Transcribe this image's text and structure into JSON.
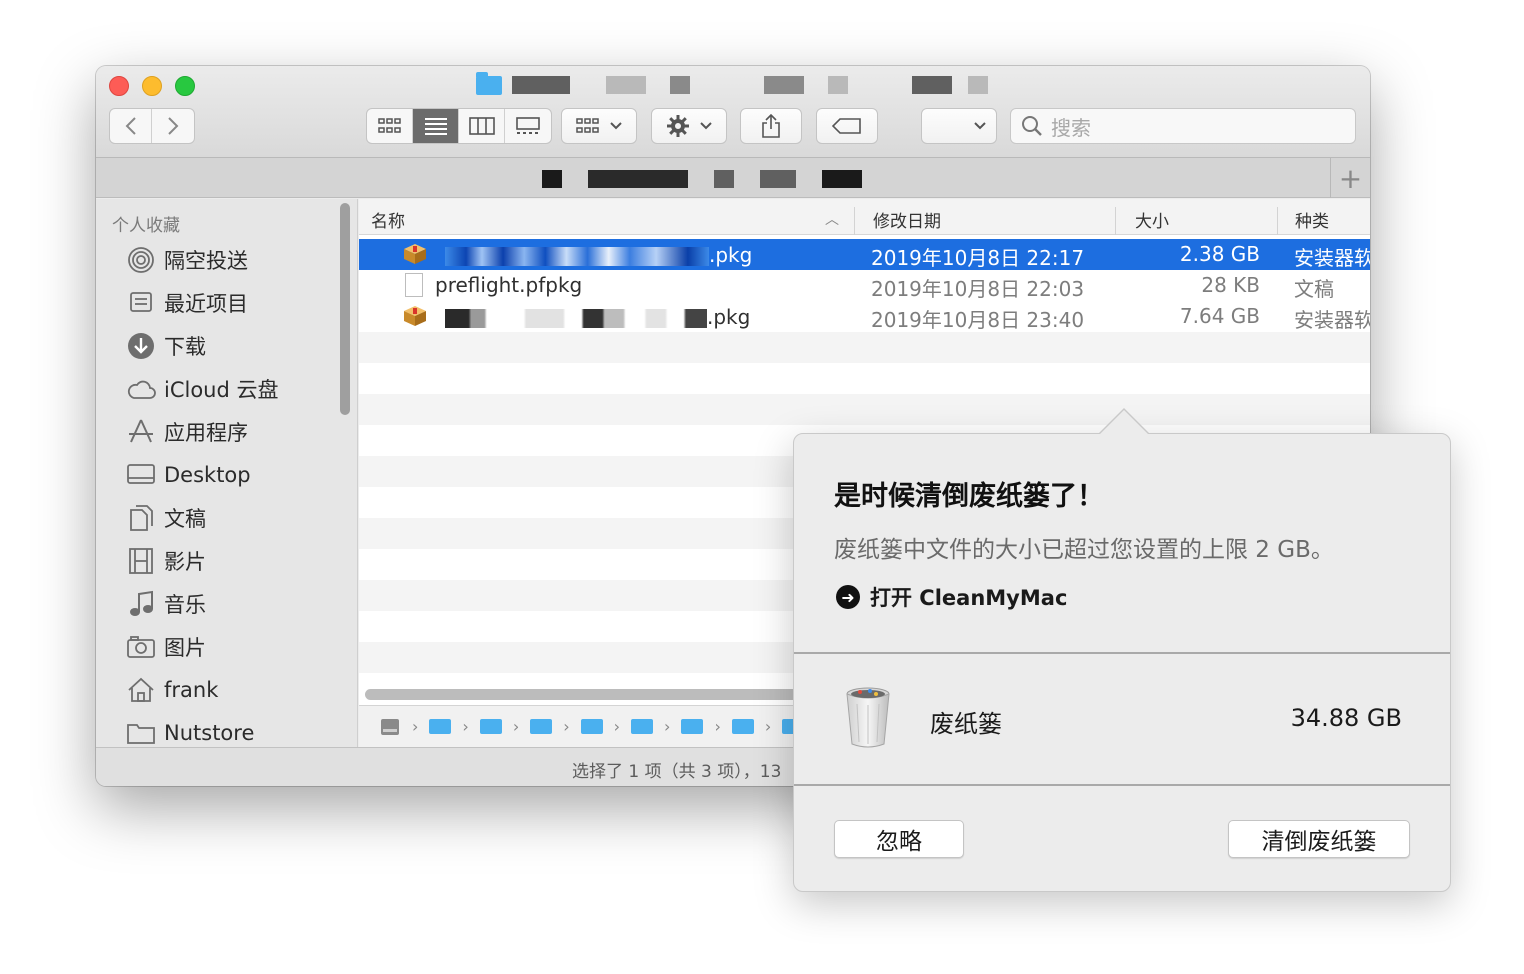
{
  "finder": {
    "search_placeholder": "搜索",
    "sidebar": {
      "section_title": "个人收藏",
      "items": [
        {
          "label": "隔空投送",
          "icon": "airdrop-icon"
        },
        {
          "label": "最近项目",
          "icon": "recents-icon"
        },
        {
          "label": "下载",
          "icon": "download-icon"
        },
        {
          "label": "iCloud 云盘",
          "icon": "cloud-icon"
        },
        {
          "label": "应用程序",
          "icon": "applications-icon"
        },
        {
          "label": "Desktop",
          "icon": "desktop-icon"
        },
        {
          "label": "文稿",
          "icon": "documents-icon"
        },
        {
          "label": "影片",
          "icon": "movies-icon"
        },
        {
          "label": "音乐",
          "icon": "music-icon"
        },
        {
          "label": "图片",
          "icon": "pictures-icon"
        },
        {
          "label": "frank",
          "icon": "home-icon"
        },
        {
          "label": "Nutstore",
          "icon": "folder-icon"
        }
      ]
    },
    "columns": {
      "name": "名称",
      "date": "修改日期",
      "size": "大小",
      "kind": "种类"
    },
    "files": [
      {
        "name_suffix": ".pkg",
        "date": "2019年10月8日 22:17",
        "size": "2.38 GB",
        "kind": "安装器软",
        "selected": true
      },
      {
        "name": "preflight.pfpkg",
        "date": "2019年10月8日 22:03",
        "size": "28 KB",
        "kind": "文稿",
        "selected": false
      },
      {
        "name_suffix": ".pkg",
        "date": "2019年10月8日 23:40",
        "size": "7.64 GB",
        "kind": "安装器软",
        "selected": false
      }
    ],
    "status_text": "选择了 1 项（共 3 项），13"
  },
  "popover": {
    "title": "是时候清倒废纸篓了！",
    "description": "废纸篓中文件的大小已超过您设置的上限 2 GB。",
    "open_action": "打开 CleanMyMac",
    "trash_label": "废纸篓",
    "trash_size": "34.88 GB",
    "ignore_button": "忽略",
    "empty_button": "清倒废纸篓"
  },
  "colors": {
    "selection": "#1d6ee0",
    "close": "#fd5c56",
    "minimize": "#fdbc2e",
    "zoom": "#28c840",
    "folder": "#4ab0ef"
  }
}
